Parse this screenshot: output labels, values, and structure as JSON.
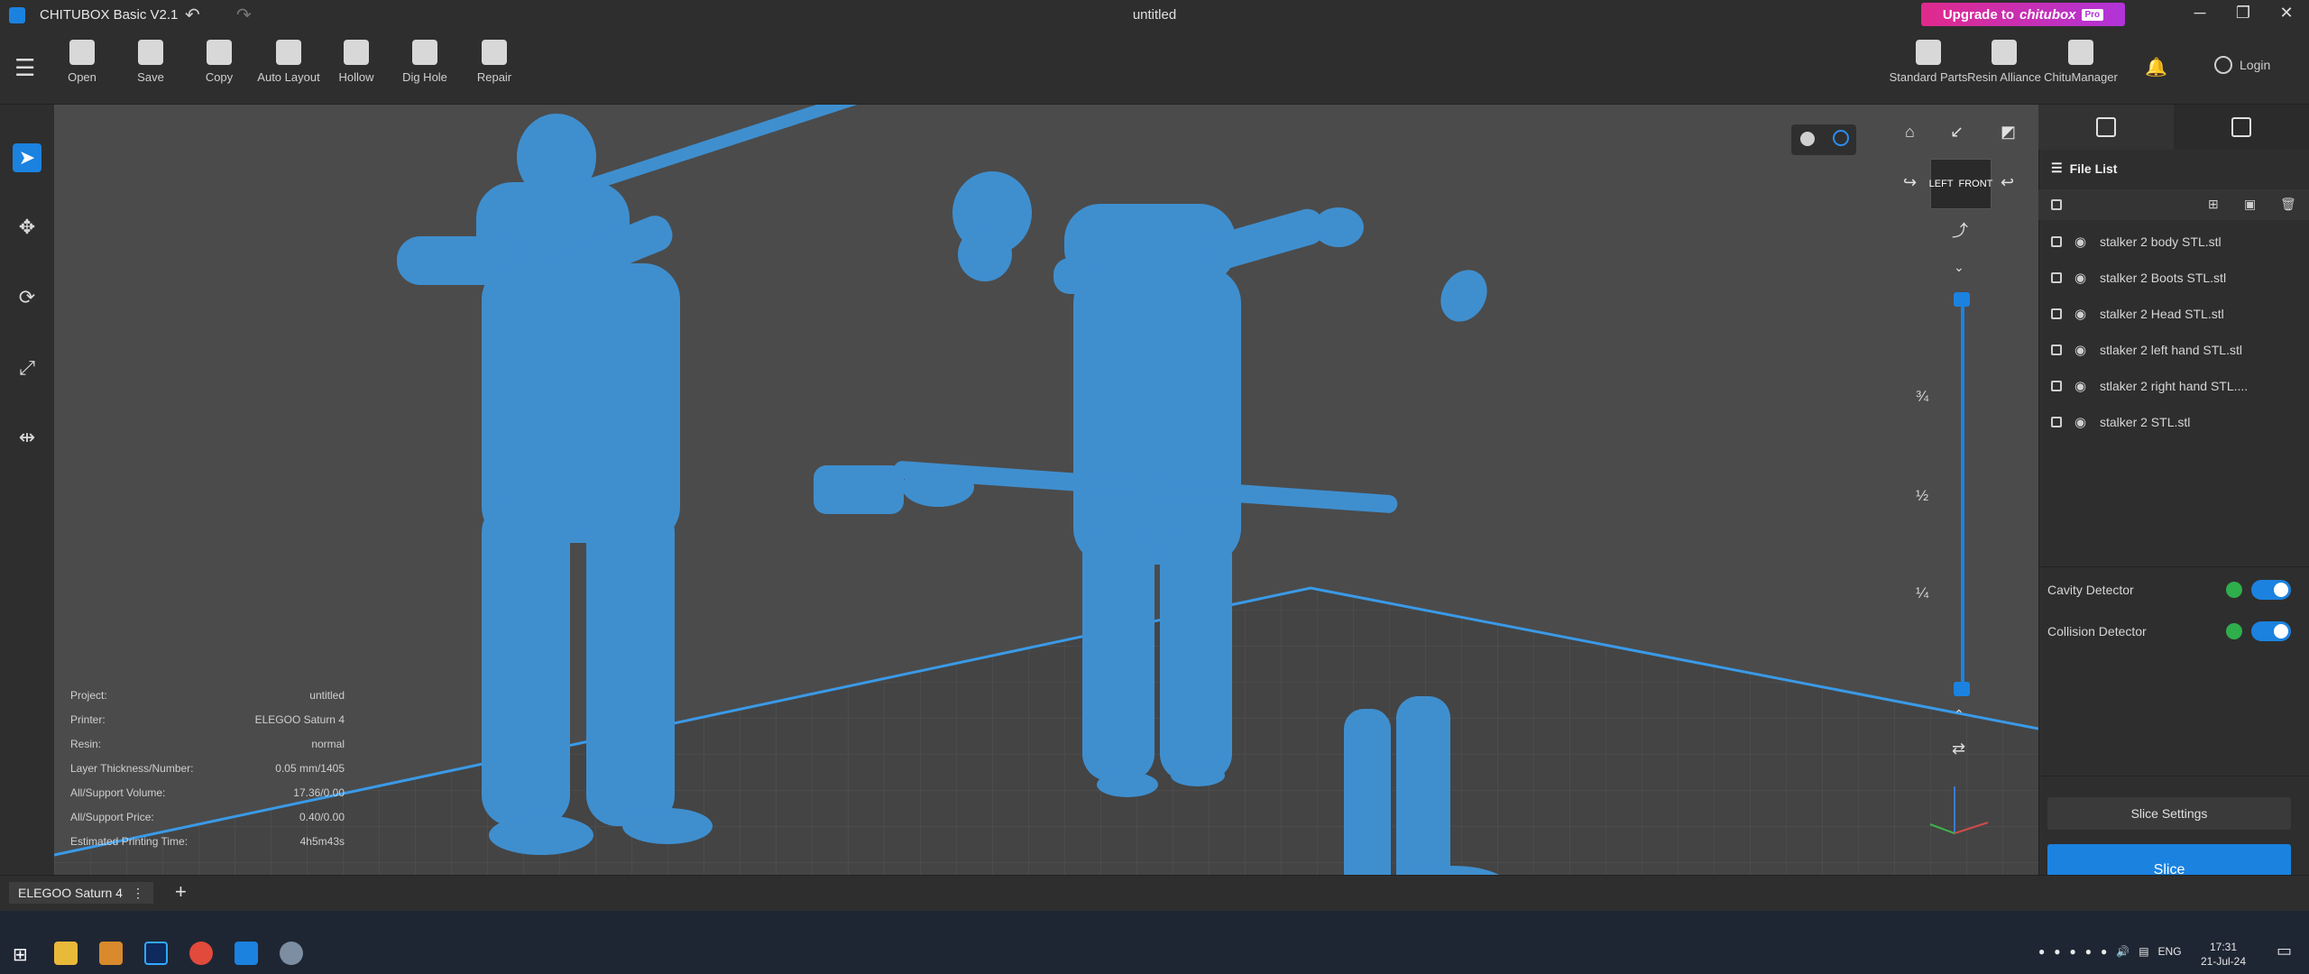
{
  "window": {
    "app_title": "CHITUBOX Basic V2.1",
    "document_title": "untitled",
    "upgrade": {
      "prefix": "Upgrade to",
      "brand": "chitubox",
      "badge": "Pro"
    }
  },
  "toolbar": {
    "tools": [
      {
        "label": "Open"
      },
      {
        "label": "Save"
      },
      {
        "label": "Copy"
      },
      {
        "label": "Auto Layout"
      },
      {
        "label": "Hollow"
      },
      {
        "label": "Dig Hole"
      },
      {
        "label": "Repair"
      }
    ],
    "right_tools": [
      {
        "label": "Standard Parts"
      },
      {
        "label": "Resin Alliance"
      },
      {
        "label": "ChituManager"
      }
    ],
    "login_label": "Login"
  },
  "info": [
    {
      "label": "Project:",
      "value": "untitled"
    },
    {
      "label": "Printer:",
      "value": "ELEGOO Saturn 4"
    },
    {
      "label": "Resin:",
      "value": "normal"
    },
    {
      "label": "Layer Thickness/Number:",
      "value": "0.05 mm/1405"
    },
    {
      "label": "All/Support Volume:",
      "value": "17.36/0.00"
    },
    {
      "label": "All/Support Price:",
      "value": "0.40/0.00"
    },
    {
      "label": "Estimated Printing Time:",
      "value": "4h5m43s"
    }
  ],
  "view_cube": {
    "left": "LEFT",
    "front": "FRONT"
  },
  "layer_slider": {
    "marks": [
      "¾",
      "½",
      "¼"
    ]
  },
  "file_list": {
    "title": "File List",
    "files": [
      "stalker 2 body STL.stl",
      "stalker 2 Boots STL.stl",
      "stalker 2 Head STL.stl",
      "stlaker 2 left hand STL.stl",
      "stlaker 2 right hand STL....",
      "stalker 2 STL.stl"
    ]
  },
  "detectors": [
    {
      "label": "Cavity Detector"
    },
    {
      "label": "Collision Detector"
    }
  ],
  "actions": {
    "slice_settings": "Slice Settings",
    "slice": "Slice"
  },
  "tabs": {
    "printer": "ELEGOO Saturn 4"
  },
  "taskbar": {
    "language": "ENG",
    "time": "17:31",
    "date": "21-Jul-24"
  },
  "colors": {
    "accent": "#1b82e0",
    "model": "#3f8fcf",
    "viewport": "#4b4b4b"
  }
}
